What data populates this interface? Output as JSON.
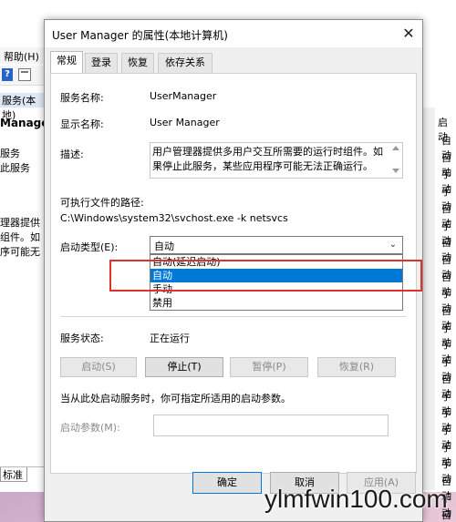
{
  "background": {
    "menu_help": "帮助(H)",
    "help_icon_glyph": "?",
    "left_header": "服务(本地)",
    "left_service_name": "Manager",
    "left_lines": [
      "服务",
      "此服务",
      "理器提供",
      "组件。如",
      "序可能无"
    ],
    "tab_label": "标准",
    "right_header": "启动",
    "right_column": [
      "自动",
      "自动",
      "手动",
      "手动",
      "自动",
      "手动",
      "自动",
      "自动",
      "自动",
      "手动",
      "自动",
      "手动",
      "手动",
      "手动",
      "自动",
      "手动",
      "手动",
      "手动",
      "手动",
      "手动",
      "自动",
      "手动",
      "自动"
    ]
  },
  "dialog": {
    "title": "User Manager 的属性(本地计算机)",
    "close_glyph": "✕",
    "tabs": [
      "常规",
      "登录",
      "恢复",
      "依存关系"
    ],
    "general": {
      "service_name_label": "服务名称:",
      "service_name": "UserManager",
      "display_name_label": "显示名称:",
      "display_name": "User Manager",
      "description_label": "描述:",
      "description": "用户管理器提供多用户交互所需要的运行时组件。如果停止此服务，某些应用程序可能无法正确运行。",
      "exe_path_label": "可执行文件的路径:",
      "exe_path": "C:\\Windows\\system32\\svchost.exe -k netsvcs",
      "startup_type_label": "启动类型(E):",
      "startup_type_value": "自动",
      "startup_options": [
        "自动(延迟启动)",
        "自动",
        "手动",
        "禁用"
      ],
      "startup_selected_index": 1,
      "service_status_label": "服务状态:",
      "service_status": "正在运行",
      "buttons": {
        "start": "启动(S)",
        "stop": "停止(T)",
        "pause": "暂停(P)",
        "resume": "恢复(R)"
      },
      "hint": "当从此处启动服务时，你可指定所适用的启动参数。",
      "params_label": "启动参数(M):",
      "params_value": ""
    },
    "footer": {
      "ok": "确定",
      "cancel": "取消",
      "apply": "应用(A)"
    }
  },
  "watermark": "ylmfwin100.com",
  "colors": {
    "highlight": "#0078d7",
    "annotation_box": "#e03030"
  }
}
